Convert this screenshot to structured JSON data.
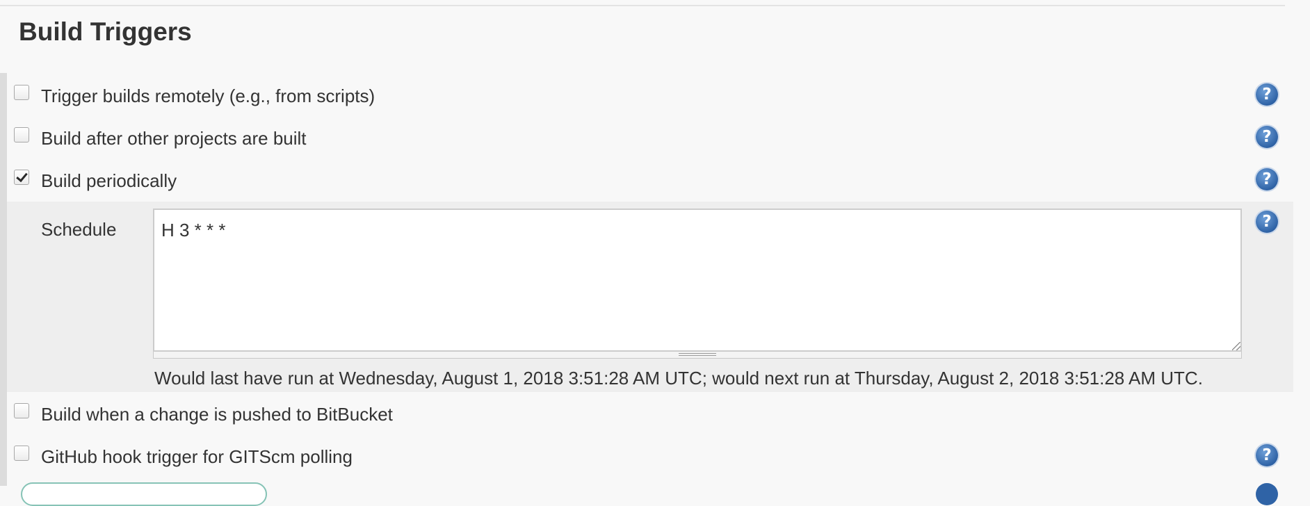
{
  "section": {
    "title": "Build Triggers"
  },
  "triggers": [
    {
      "label": "Trigger builds remotely (e.g., from scripts)",
      "checked": false,
      "help": true
    },
    {
      "label": "Build after other projects are built",
      "checked": false,
      "help": true
    },
    {
      "label": "Build periodically",
      "checked": true,
      "help": true
    },
    {
      "label": "Build when a change is pushed to BitBucket",
      "checked": false,
      "help": false
    },
    {
      "label": "GitHub hook trigger for GITScm polling",
      "checked": false,
      "help": true
    }
  ],
  "schedule": {
    "label": "Schedule",
    "value": "H 3 * * *",
    "info": "Would last have run at Wednesday, August 1, 2018 3:51:28 AM UTC; would next run at Thursday, August 2, 2018 3:51:28 AM UTC."
  },
  "icons": {
    "help": "help-icon",
    "help_glyph": "?"
  },
  "colors": {
    "help_icon": "#2f63a6",
    "background": "#f8f8f8",
    "schedule_block": "#eeeeee"
  }
}
